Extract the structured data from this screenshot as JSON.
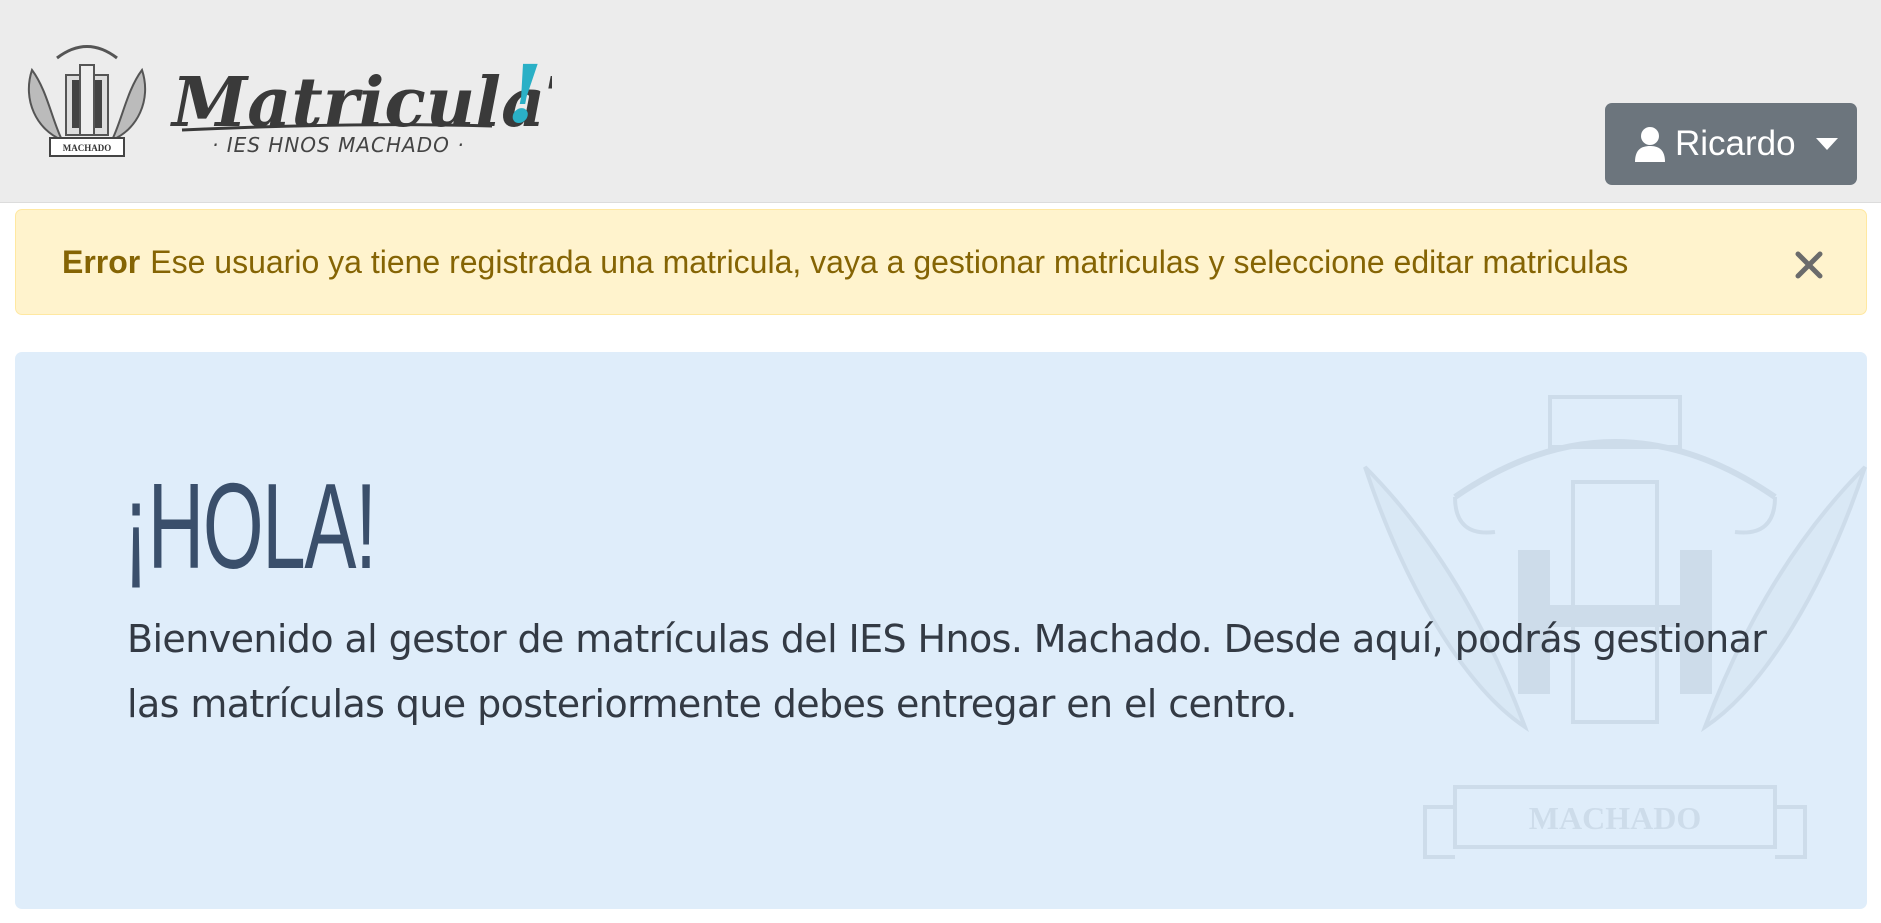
{
  "header": {
    "logo": {
      "brand": "MatriculaT",
      "brand_accent": "!",
      "tagline": "· IES HNOS  MACHADO ·",
      "emblem_text": "MACHADO"
    },
    "user_menu": {
      "name": "Ricardo",
      "icon": "user-icon"
    }
  },
  "alert": {
    "title": "Error",
    "message": "Ese usuario ya tiene registrada una matricula, vaya a gestionar matriculas y seleccione editar matriculas",
    "close_symbol": "×"
  },
  "welcome": {
    "greeting": "¡HOLA!",
    "text": "Bienvenido al gestor de matrículas del IES Hnos. Machado. Desde aquí, podrás gestionar las matrículas que posteriormente debes entregar en el centro.",
    "watermark_text": "MACHADO"
  },
  "colors": {
    "navbar_bg": "#ececec",
    "user_button": "#6c757d",
    "alert_bg": "#fff3cd",
    "alert_text": "#856404",
    "jumbotron_bg": "#dfedfa",
    "brand_accent": "#2ab0c6"
  }
}
